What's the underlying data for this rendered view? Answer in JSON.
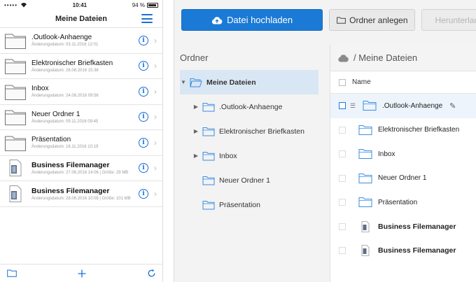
{
  "phone": {
    "status": {
      "signal": "•••••",
      "time": "10:41",
      "battery": "94 %"
    },
    "title": "Meine Dateien",
    "items": [
      {
        "name": ".Outlook-Anhaenge",
        "meta": "Änderungsdatum: 03.11.2016 12:01",
        "kind": "folder"
      },
      {
        "name": "Elektronischer Briefkasten",
        "meta": "Änderungsdatum: 26.08.2016 15:36",
        "kind": "folder"
      },
      {
        "name": "Inbox",
        "meta": "Änderungsdatum: 24.08.2016 09:56",
        "kind": "folder"
      },
      {
        "name": "Neuer Ordner 1",
        "meta": "Änderungsdatum: 09.11.2016 09:45",
        "kind": "folder"
      },
      {
        "name": "Präsentation",
        "meta": "Änderungsdatum: 16.11.2016 10:19",
        "kind": "folder"
      },
      {
        "name": "Business Filemanager",
        "meta": "Änderungsdatum: 27.06.2016 14:06 | Größe: 29 MB",
        "kind": "file"
      },
      {
        "name": "Business Filemanager",
        "meta": "Änderungsdatum: 28.06.2016 10:08 | Größe: 101 MB",
        "kind": "file"
      }
    ],
    "info_glyph": "i",
    "chevron_glyph": "›",
    "tab_icons": [
      "folder-icon",
      "add-icon",
      "refresh-icon"
    ]
  },
  "web": {
    "toolbar": {
      "upload_label": "Datei hochladen",
      "new_folder_label": "Ordner anlegen",
      "download_label": "Herunterladen"
    },
    "tree": {
      "heading": "Ordner",
      "root": "Meine Dateien",
      "children": [
        {
          "label": ".Outlook-Anhaenge",
          "expandable": true
        },
        {
          "label": "Elektronischer Briefkasten",
          "expandable": true
        },
        {
          "label": "Inbox",
          "expandable": true
        },
        {
          "label": "Neuer Ordner 1",
          "expandable": false
        },
        {
          "label": "Präsentation",
          "expandable": false
        }
      ]
    },
    "files": {
      "path": "/ Meine Dateien",
      "column_name": "Name",
      "rows": [
        {
          "name": ".Outlook-Anhaenge",
          "kind": "folder",
          "selected": true
        },
        {
          "name": "Elektronischer Briefkasten",
          "kind": "folder"
        },
        {
          "name": "Inbox",
          "kind": "folder"
        },
        {
          "name": "Neuer Ordner 1",
          "kind": "folder"
        },
        {
          "name": "Präsentation",
          "kind": "folder"
        },
        {
          "name": "Business Filemanager",
          "kind": "file"
        },
        {
          "name": "Business Filemanager",
          "kind": "file"
        }
      ]
    }
  },
  "colors": {
    "accent": "#1b7ad6",
    "selected_bg": "#d9e7f4",
    "folder_stroke": "#3a8ee0"
  }
}
